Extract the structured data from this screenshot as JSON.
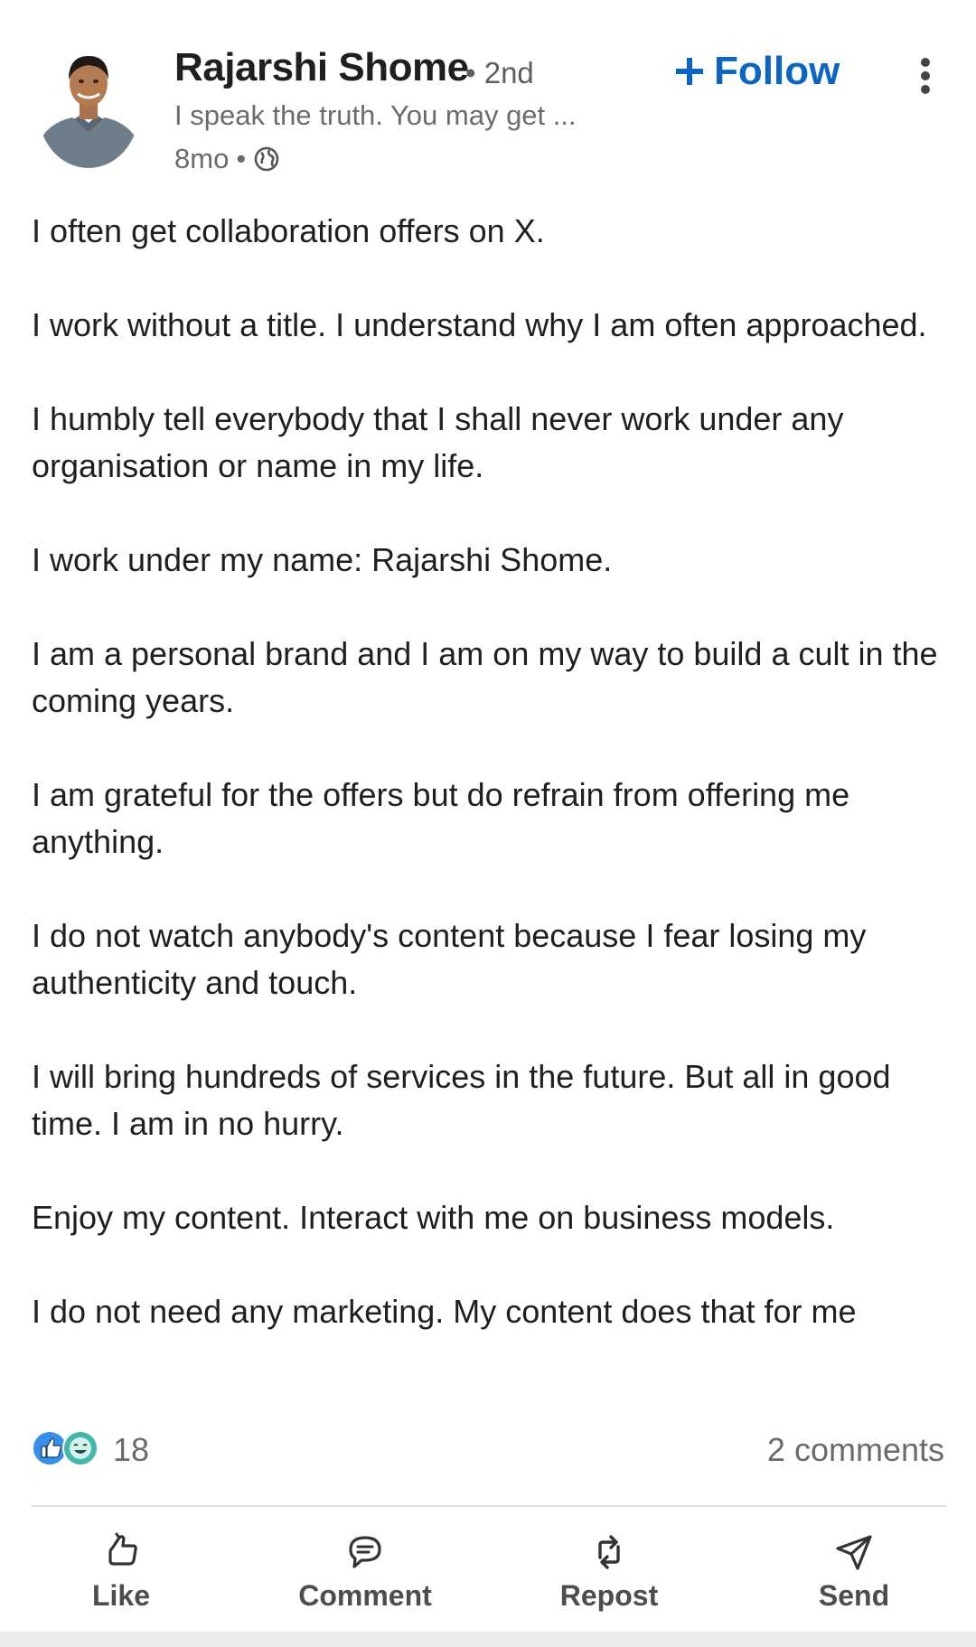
{
  "author": {
    "name": "Rajarshi Shome",
    "degree": "• 2nd",
    "headline": "I speak the truth. You may get ...",
    "time_ago": "8mo",
    "separator": "•",
    "visibility_icon": "globe-icon"
  },
  "header_actions": {
    "follow_label": "Follow",
    "follow_icon": "plus-icon",
    "more_icon": "more-vertical-icon",
    "accent_color": "#0a66c2"
  },
  "post": {
    "paragraphs": [
      "I often get collaboration offers on X.",
      "I work without a title. I understand why I am often approached.",
      "I humbly tell everybody that I shall never work under any organisation or name in my life.",
      "I work under my name: Rajarshi Shome.",
      "I am a personal brand and I am on my way to build a cult in the coming years.",
      "I am grateful for the offers but do refrain from offering me anything.",
      "I do not watch anybody's content because I fear losing my authenticity and touch.",
      "I will bring hundreds of services in the future. But all in good time. I am in no hurry.",
      "Enjoy my content. Interact with me on business models.",
      "I do not need any marketing. My content does that for me"
    ]
  },
  "social": {
    "reaction_icons": [
      "like-reaction-icon",
      "funny-reaction-icon"
    ],
    "reaction_count": "18",
    "comments": "2 comments"
  },
  "actions": [
    {
      "label": "Like",
      "icon": "thumbs-up-icon"
    },
    {
      "label": "Comment",
      "icon": "comment-icon"
    },
    {
      "label": "Repost",
      "icon": "repost-icon"
    },
    {
      "label": "Send",
      "icon": "send-icon"
    }
  ]
}
